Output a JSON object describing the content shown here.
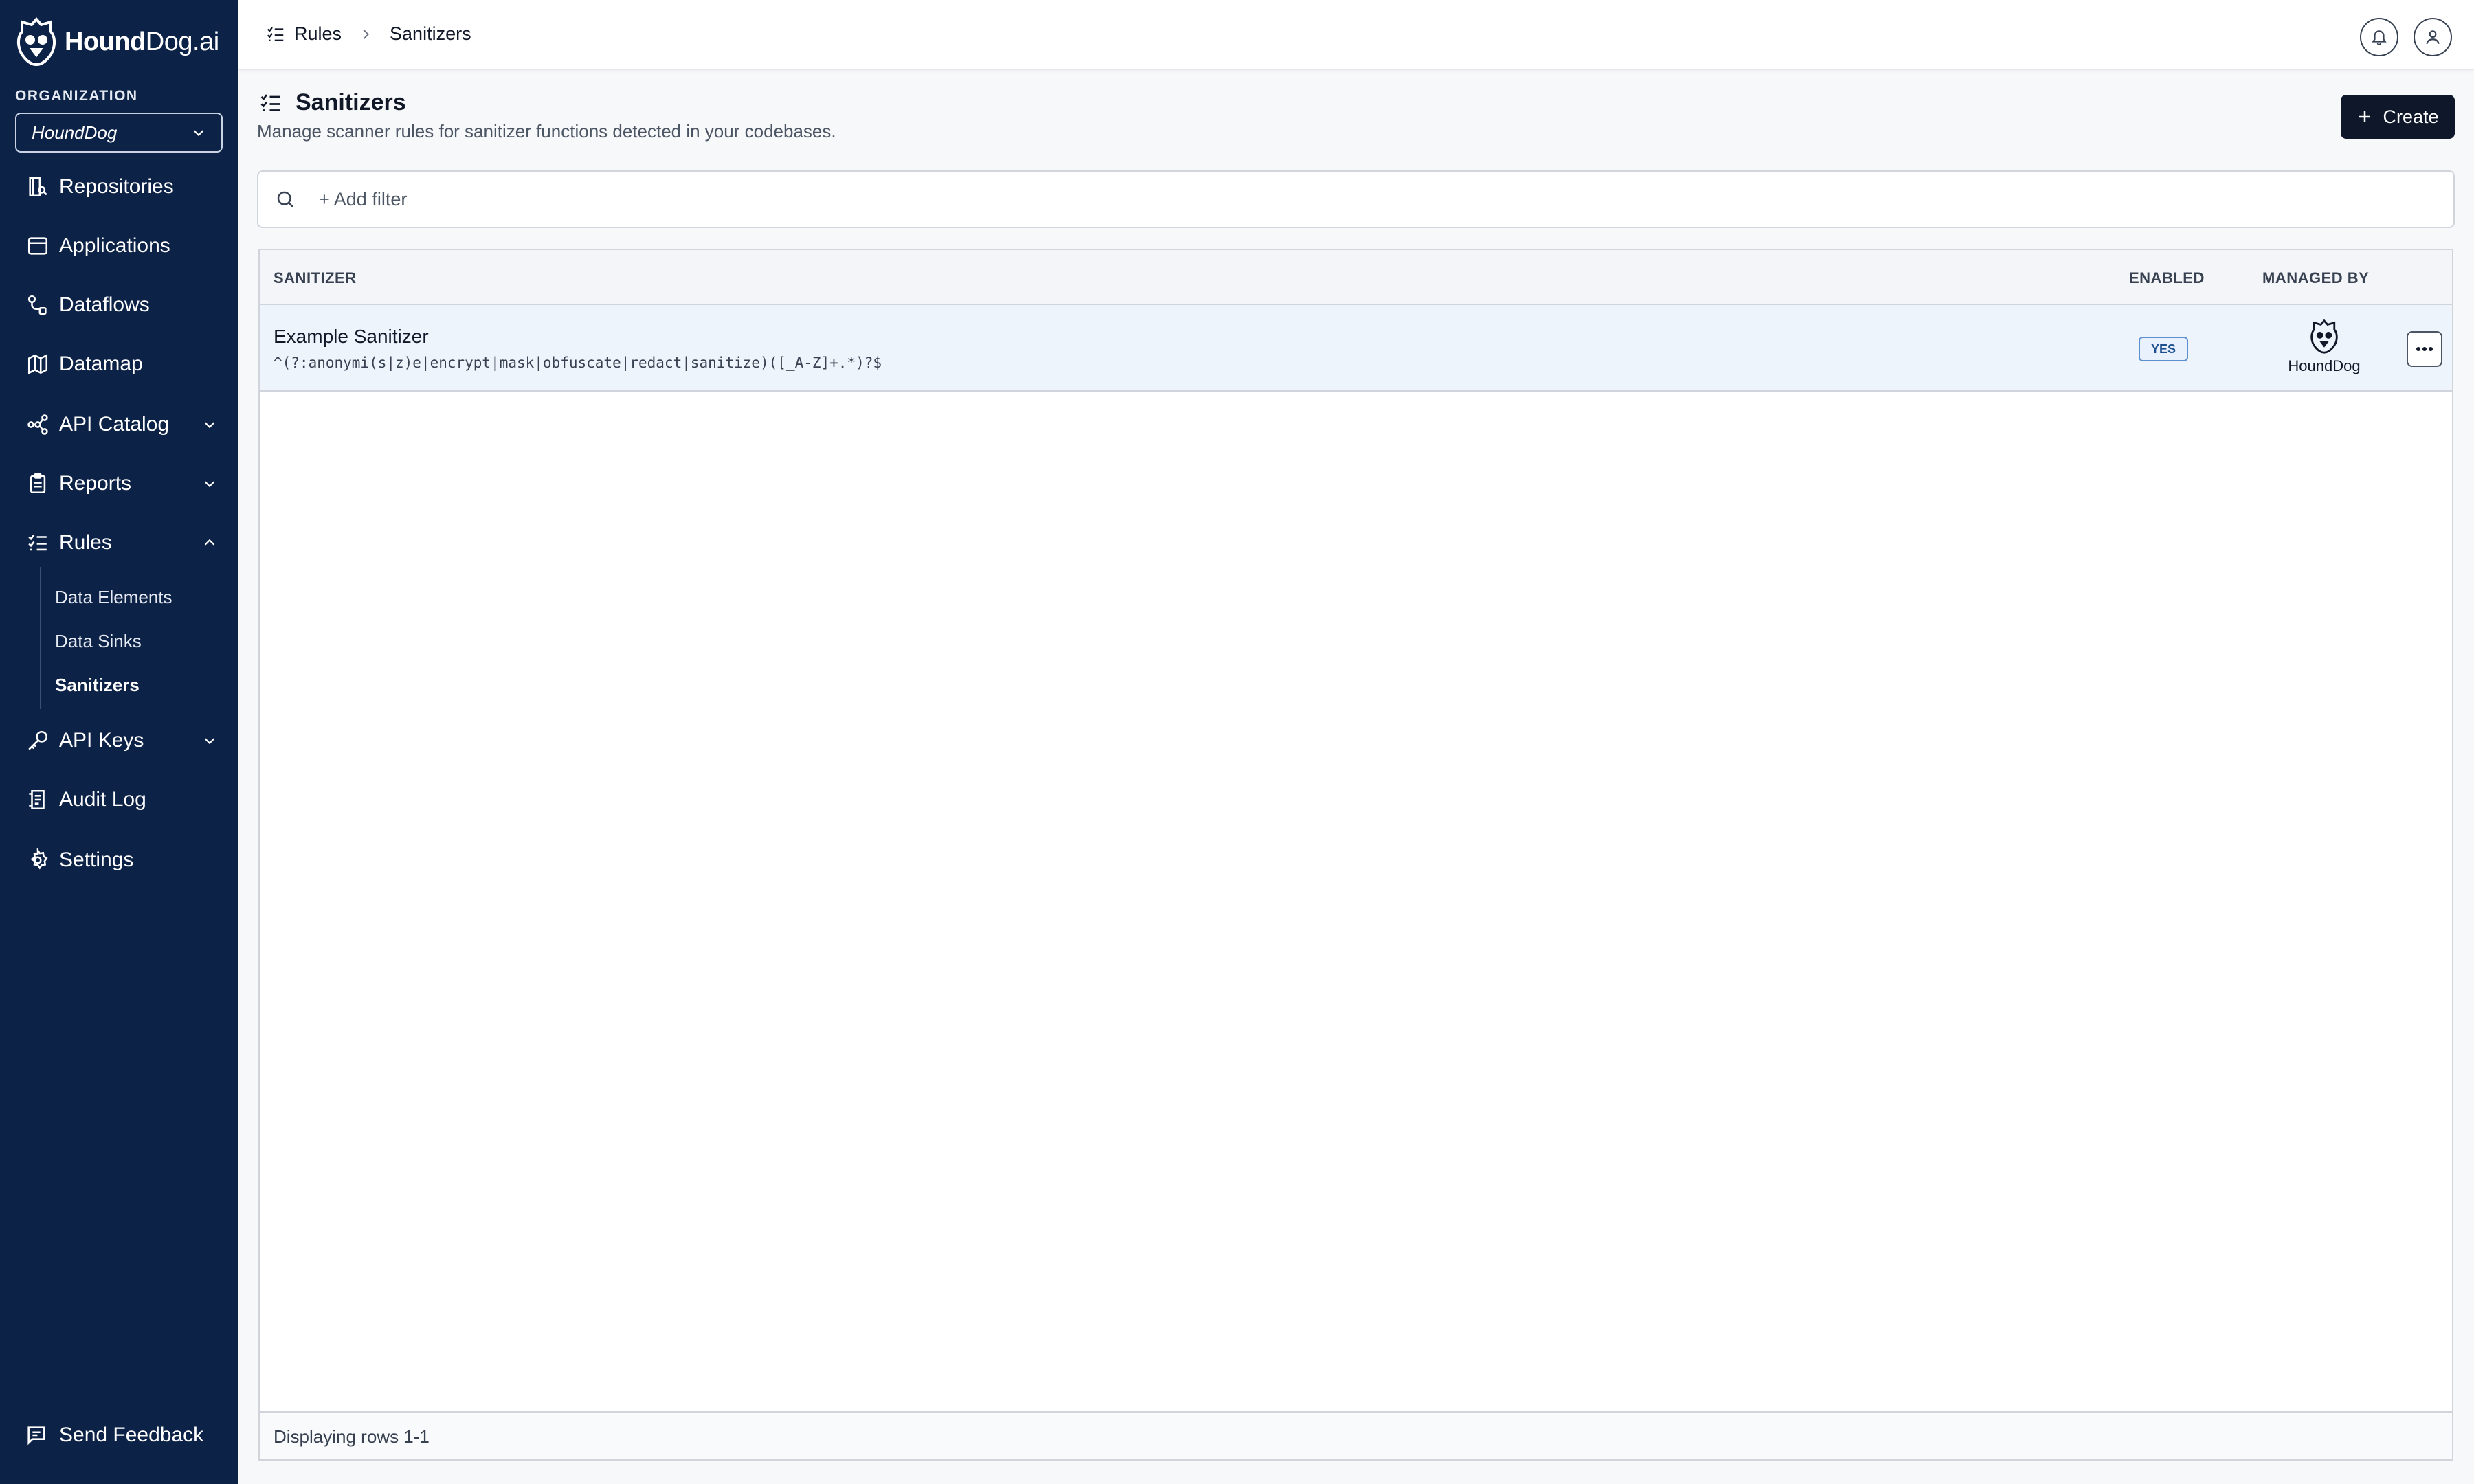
{
  "brand": {
    "name_bold": "Hound",
    "name_rest": "Dog.ai"
  },
  "organization": {
    "label": "ORGANIZATION",
    "selected": "HoundDog"
  },
  "sidebar": {
    "items": [
      {
        "label": "Repositories",
        "icon": "repositories-icon"
      },
      {
        "label": "Applications",
        "icon": "applications-icon"
      },
      {
        "label": "Dataflows",
        "icon": "dataflows-icon"
      },
      {
        "label": "Datamap",
        "icon": "datamap-icon"
      },
      {
        "label": "API Catalog",
        "icon": "api-catalog-icon"
      },
      {
        "label": "Reports",
        "icon": "reports-icon"
      },
      {
        "label": "Rules",
        "icon": "rules-icon"
      },
      {
        "label": "API Keys",
        "icon": "key-icon"
      },
      {
        "label": "Audit Log",
        "icon": "audit-log-icon"
      },
      {
        "label": "Settings",
        "icon": "gear-icon"
      }
    ],
    "rules_sub": [
      {
        "label": "Data Elements"
      },
      {
        "label": "Data Sinks"
      },
      {
        "label": "Sanitizers"
      }
    ],
    "feedback": "Send Feedback"
  },
  "breadcrumb": {
    "parent": "Rules",
    "current": "Sanitizers"
  },
  "page": {
    "title": "Sanitizers",
    "subtitle": "Manage scanner rules for sanitizer functions detected in your codebases.",
    "create_label": "Create"
  },
  "filter": {
    "placeholder": "+ Add filter"
  },
  "table": {
    "columns": {
      "sanitizer": "SANITIZER",
      "enabled": "ENABLED",
      "managed_by": "MANAGED BY"
    },
    "rows": [
      {
        "name": "Example Sanitizer",
        "pattern": "^(?:anonymi(s|z)e|encrypt|mask|obfuscate|redact|sanitize)([_A-Z]+.*)?$",
        "enabled": "YES",
        "managed_by": "HoundDog"
      }
    ],
    "footer": "Displaying rows 1-1"
  },
  "colors": {
    "sidebar_bg": "#0d2247",
    "primary_button": "#0f172a",
    "row_highlight": "#eef4fc"
  }
}
